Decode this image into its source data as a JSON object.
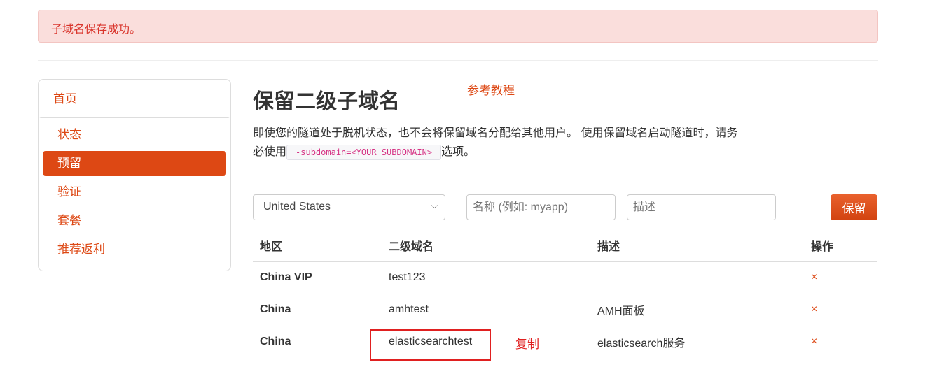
{
  "alert": "子域名保存成功。",
  "sidebar": {
    "items": [
      {
        "label": "首页"
      },
      {
        "label": "状态"
      },
      {
        "label": "预留"
      },
      {
        "label": "验证"
      },
      {
        "label": "套餐"
      },
      {
        "label": "推荐返利"
      }
    ]
  },
  "title": "保留二级子域名",
  "tutorial_link": "参考教程",
  "description": {
    "before": "即使您的隧道处于脱机状态，也不会将保留域名分配给其他用户。 使用保留域名启动隧道时，请务必使用",
    "code": "-subdomain=<YOUR_SUBDOMAIN>",
    "after": "选项。"
  },
  "form": {
    "region": "United States",
    "name_placeholder": "名称 (例如: myapp)",
    "desc_placeholder": "描述",
    "save": "保留"
  },
  "table": {
    "headers": [
      "地区",
      "二级域名",
      "描述",
      "操作"
    ],
    "rows": [
      {
        "region": "China VIP",
        "subdomain": "test123",
        "desc": "",
        "action": "×"
      },
      {
        "region": "China",
        "subdomain": "amhtest",
        "desc": "AMH面板",
        "action": "×"
      },
      {
        "region": "China",
        "subdomain": "elasticsearchtest",
        "desc": "elasticsearch服务",
        "action": "×"
      }
    ]
  },
  "annotation": "复制",
  "colors": {
    "accent": "#dd4814",
    "alert_bg": "#fadedc",
    "annotation": "#e02020"
  },
  "icons": {
    "select": "chevron-down-icon",
    "delete": "close-icon"
  }
}
